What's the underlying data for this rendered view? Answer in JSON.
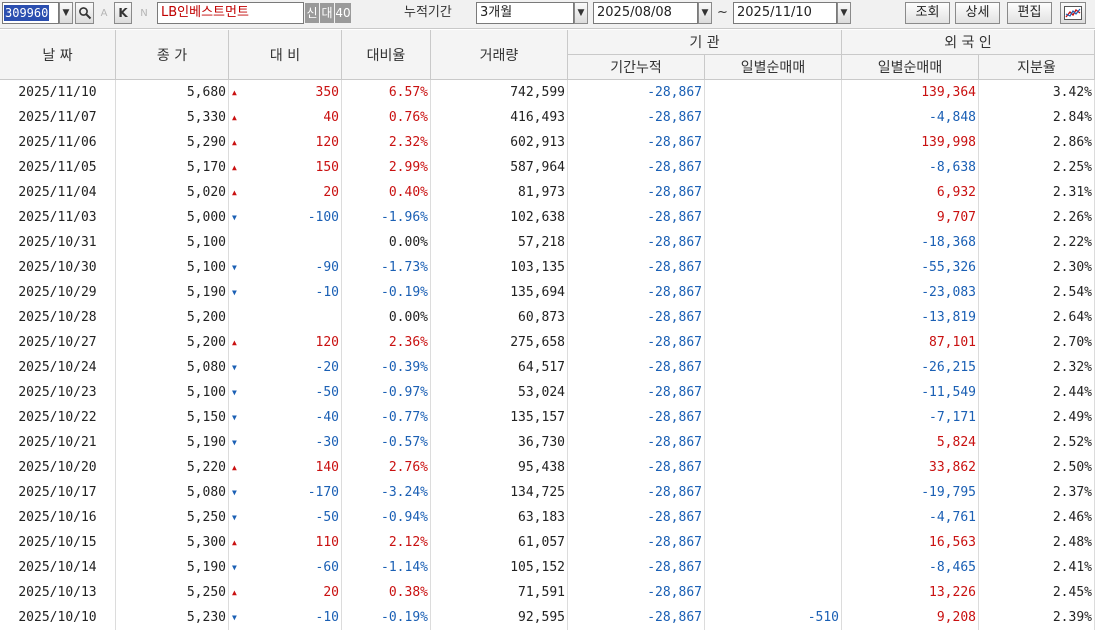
{
  "toolbar": {
    "code": "309960",
    "letters": [
      "A",
      "K",
      "N"
    ],
    "name": "LB인베스트먼트",
    "badges": [
      "신",
      "대",
      "40"
    ],
    "period_label": "누적기간",
    "period_value": "3개월",
    "date_from": "2025/08/08",
    "tilde": "~",
    "date_to": "2025/11/10",
    "buttons": {
      "query": "조회",
      "detail": "상세",
      "edit": "편집"
    }
  },
  "colors": {
    "up": "#c91010",
    "down": "#1a5fb4",
    "header_bg": "#f4f4f4",
    "code_highlight": "#2b4fb0"
  },
  "header": {
    "date": "날 짜",
    "close": "종 가",
    "change": "대 비",
    "change_rate": "대비율",
    "volume": "거래량",
    "institution": "기   관",
    "inst_period": "기간누적",
    "inst_daily": "일별순매매",
    "foreign": "외 국 인",
    "foreign_daily": "일별순매매",
    "foreign_ratio": "지분율"
  },
  "rows": [
    {
      "date": "2025/11/10",
      "close": "5,680",
      "dir": "up",
      "change": "350",
      "rate": "6.57%",
      "volume": "742,599",
      "inst_period": "-28,867",
      "inst_daily": "",
      "foreign_daily": "139,364",
      "foreign_dir": "up",
      "ratio": "3.42%"
    },
    {
      "date": "2025/11/07",
      "close": "5,330",
      "dir": "up",
      "change": "40",
      "rate": "0.76%",
      "volume": "416,493",
      "inst_period": "-28,867",
      "inst_daily": "",
      "foreign_daily": "-4,848",
      "foreign_dir": "down",
      "ratio": "2.84%"
    },
    {
      "date": "2025/11/06",
      "close": "5,290",
      "dir": "up",
      "change": "120",
      "rate": "2.32%",
      "volume": "602,913",
      "inst_period": "-28,867",
      "inst_daily": "",
      "foreign_daily": "139,998",
      "foreign_dir": "up",
      "ratio": "2.86%"
    },
    {
      "date": "2025/11/05",
      "close": "5,170",
      "dir": "up",
      "change": "150",
      "rate": "2.99%",
      "volume": "587,964",
      "inst_period": "-28,867",
      "inst_daily": "",
      "foreign_daily": "-8,638",
      "foreign_dir": "down",
      "ratio": "2.25%"
    },
    {
      "date": "2025/11/04",
      "close": "5,020",
      "dir": "up",
      "change": "20",
      "rate": "0.40%",
      "volume": "81,973",
      "inst_period": "-28,867",
      "inst_daily": "",
      "foreign_daily": "6,932",
      "foreign_dir": "up",
      "ratio": "2.31%"
    },
    {
      "date": "2025/11/03",
      "close": "5,000",
      "dir": "down",
      "change": "-100",
      "rate": "-1.96%",
      "volume": "102,638",
      "inst_period": "-28,867",
      "inst_daily": "",
      "foreign_daily": "9,707",
      "foreign_dir": "up",
      "ratio": "2.26%"
    },
    {
      "date": "2025/10/31",
      "close": "5,100",
      "dir": "none",
      "change": "",
      "rate": "0.00%",
      "volume": "57,218",
      "inst_period": "-28,867",
      "inst_daily": "",
      "foreign_daily": "-18,368",
      "foreign_dir": "down",
      "ratio": "2.22%"
    },
    {
      "date": "2025/10/30",
      "close": "5,100",
      "dir": "down",
      "change": "-90",
      "rate": "-1.73%",
      "volume": "103,135",
      "inst_period": "-28,867",
      "inst_daily": "",
      "foreign_daily": "-55,326",
      "foreign_dir": "down",
      "ratio": "2.30%"
    },
    {
      "date": "2025/10/29",
      "close": "5,190",
      "dir": "down",
      "change": "-10",
      "rate": "-0.19%",
      "volume": "135,694",
      "inst_period": "-28,867",
      "inst_daily": "",
      "foreign_daily": "-23,083",
      "foreign_dir": "down",
      "ratio": "2.54%"
    },
    {
      "date": "2025/10/28",
      "close": "5,200",
      "dir": "none",
      "change": "",
      "rate": "0.00%",
      "volume": "60,873",
      "inst_period": "-28,867",
      "inst_daily": "",
      "foreign_daily": "-13,819",
      "foreign_dir": "down",
      "ratio": "2.64%"
    },
    {
      "date": "2025/10/27",
      "close": "5,200",
      "dir": "up",
      "change": "120",
      "rate": "2.36%",
      "volume": "275,658",
      "inst_period": "-28,867",
      "inst_daily": "",
      "foreign_daily": "87,101",
      "foreign_dir": "up",
      "ratio": "2.70%"
    },
    {
      "date": "2025/10/24",
      "close": "5,080",
      "dir": "down",
      "change": "-20",
      "rate": "-0.39%",
      "volume": "64,517",
      "inst_period": "-28,867",
      "inst_daily": "",
      "foreign_daily": "-26,215",
      "foreign_dir": "down",
      "ratio": "2.32%"
    },
    {
      "date": "2025/10/23",
      "close": "5,100",
      "dir": "down",
      "change": "-50",
      "rate": "-0.97%",
      "volume": "53,024",
      "inst_period": "-28,867",
      "inst_daily": "",
      "foreign_daily": "-11,549",
      "foreign_dir": "down",
      "ratio": "2.44%"
    },
    {
      "date": "2025/10/22",
      "close": "5,150",
      "dir": "down",
      "change": "-40",
      "rate": "-0.77%",
      "volume": "135,157",
      "inst_period": "-28,867",
      "inst_daily": "",
      "foreign_daily": "-7,171",
      "foreign_dir": "down",
      "ratio": "2.49%"
    },
    {
      "date": "2025/10/21",
      "close": "5,190",
      "dir": "down",
      "change": "-30",
      "rate": "-0.57%",
      "volume": "36,730",
      "inst_period": "-28,867",
      "inst_daily": "",
      "foreign_daily": "5,824",
      "foreign_dir": "up",
      "ratio": "2.52%"
    },
    {
      "date": "2025/10/20",
      "close": "5,220",
      "dir": "up",
      "change": "140",
      "rate": "2.76%",
      "volume": "95,438",
      "inst_period": "-28,867",
      "inst_daily": "",
      "foreign_daily": "33,862",
      "foreign_dir": "up",
      "ratio": "2.50%"
    },
    {
      "date": "2025/10/17",
      "close": "5,080",
      "dir": "down",
      "change": "-170",
      "rate": "-3.24%",
      "volume": "134,725",
      "inst_period": "-28,867",
      "inst_daily": "",
      "foreign_daily": "-19,795",
      "foreign_dir": "down",
      "ratio": "2.37%"
    },
    {
      "date": "2025/10/16",
      "close": "5,250",
      "dir": "down",
      "change": "-50",
      "rate": "-0.94%",
      "volume": "63,183",
      "inst_period": "-28,867",
      "inst_daily": "",
      "foreign_daily": "-4,761",
      "foreign_dir": "down",
      "ratio": "2.46%"
    },
    {
      "date": "2025/10/15",
      "close": "5,300",
      "dir": "up",
      "change": "110",
      "rate": "2.12%",
      "volume": "61,057",
      "inst_period": "-28,867",
      "inst_daily": "",
      "foreign_daily": "16,563",
      "foreign_dir": "up",
      "ratio": "2.48%"
    },
    {
      "date": "2025/10/14",
      "close": "5,190",
      "dir": "down",
      "change": "-60",
      "rate": "-1.14%",
      "volume": "105,152",
      "inst_period": "-28,867",
      "inst_daily": "",
      "foreign_daily": "-8,465",
      "foreign_dir": "down",
      "ratio": "2.41%"
    },
    {
      "date": "2025/10/13",
      "close": "5,250",
      "dir": "up",
      "change": "20",
      "rate": "0.38%",
      "volume": "71,591",
      "inst_period": "-28,867",
      "inst_daily": "",
      "foreign_daily": "13,226",
      "foreign_dir": "up",
      "ratio": "2.45%"
    },
    {
      "date": "2025/10/10",
      "close": "5,230",
      "dir": "down",
      "change": "-10",
      "rate": "-0.19%",
      "volume": "92,595",
      "inst_period": "-28,867",
      "inst_daily": "-510",
      "foreign_daily": "9,208",
      "foreign_dir": "up",
      "ratio": "2.39%"
    }
  ]
}
